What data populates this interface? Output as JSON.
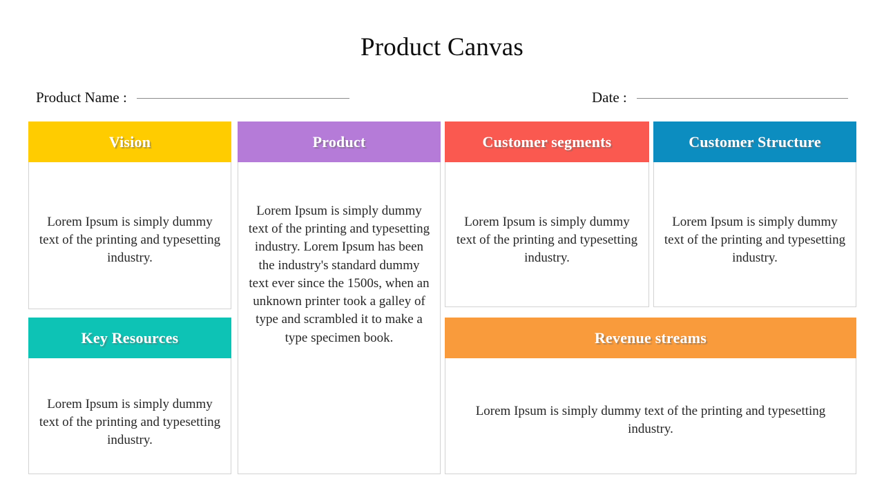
{
  "page": {
    "title": "Product Canvas"
  },
  "meta": {
    "product_name": {
      "label": "Product Name :",
      "value": ""
    },
    "date": {
      "label": "Date :",
      "value": ""
    }
  },
  "colors": {
    "vision": "#FFCC00",
    "product": "#B57BD8",
    "customer_segments": "#FA5950",
    "customer_structure": "#0C8DC0",
    "key_resources": "#0DC3B5",
    "revenue_streams": "#F99B3C",
    "card_border": "#D2D2D2",
    "header_text": "#FFFFFF",
    "body_text": "#262626"
  },
  "cards": [
    {
      "id": "vision",
      "title": "Vision",
      "body": "Lorem Ipsum is simply dummy text of the printing and typesetting industry."
    },
    {
      "id": "product",
      "title": "Product",
      "body": "Lorem Ipsum is simply dummy text of the printing and typesetting industry. Lorem Ipsum has been the industry's standard dummy text ever since the 1500s, when an unknown printer took a galley of type and scrambled it to make a type specimen book."
    },
    {
      "id": "customer_segments",
      "title": "Customer segments",
      "body": "Lorem Ipsum is simply dummy text of the printing and typesetting industry."
    },
    {
      "id": "customer_structure",
      "title": "Customer Structure",
      "body": "Lorem Ipsum is simply dummy text of the printing and typesetting industry."
    },
    {
      "id": "key_resources",
      "title": "Key Resources",
      "body": "Lorem Ipsum is simply dummy text of the printing and typesetting industry."
    },
    {
      "id": "revenue_streams",
      "title": "Revenue streams",
      "body": "Lorem Ipsum is simply dummy text of the printing and typesetting industry."
    }
  ]
}
